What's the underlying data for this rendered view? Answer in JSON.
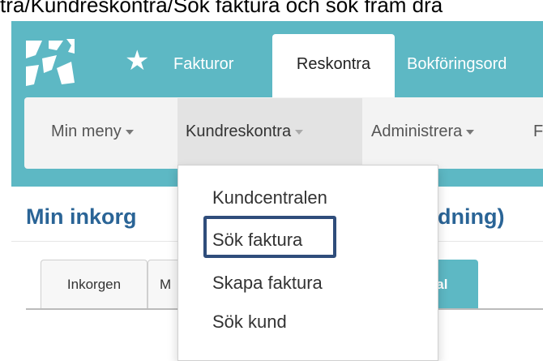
{
  "caption": "tra/Kundreskontra/Sök faktura och sök fram dra",
  "topnav": {
    "items": [
      {
        "label": "Fakturor"
      },
      {
        "label": "Reskontra"
      },
      {
        "label": "Bokföringsord"
      }
    ]
  },
  "subnav": {
    "items": [
      {
        "label": "Min meny"
      },
      {
        "label": "Kundreskontra"
      },
      {
        "label": "Administrera"
      },
      {
        "label": "F"
      }
    ]
  },
  "page": {
    "title": "Min inkorg",
    "title_tail": "dning)"
  },
  "tabs": [
    {
      "label": "Inkorgen"
    },
    {
      "label": "M"
    },
    {
      "label": "rtal"
    }
  ],
  "dropdown": {
    "items": [
      {
        "label": "Kundcentralen"
      },
      {
        "label": "Sök faktura"
      },
      {
        "label": "Skapa faktura"
      },
      {
        "label": "Sök kund"
      }
    ]
  },
  "colors": {
    "brand_teal": "#5db8c4",
    "title_blue": "#2a6496",
    "highlight_navy": "#2f4d7b"
  }
}
